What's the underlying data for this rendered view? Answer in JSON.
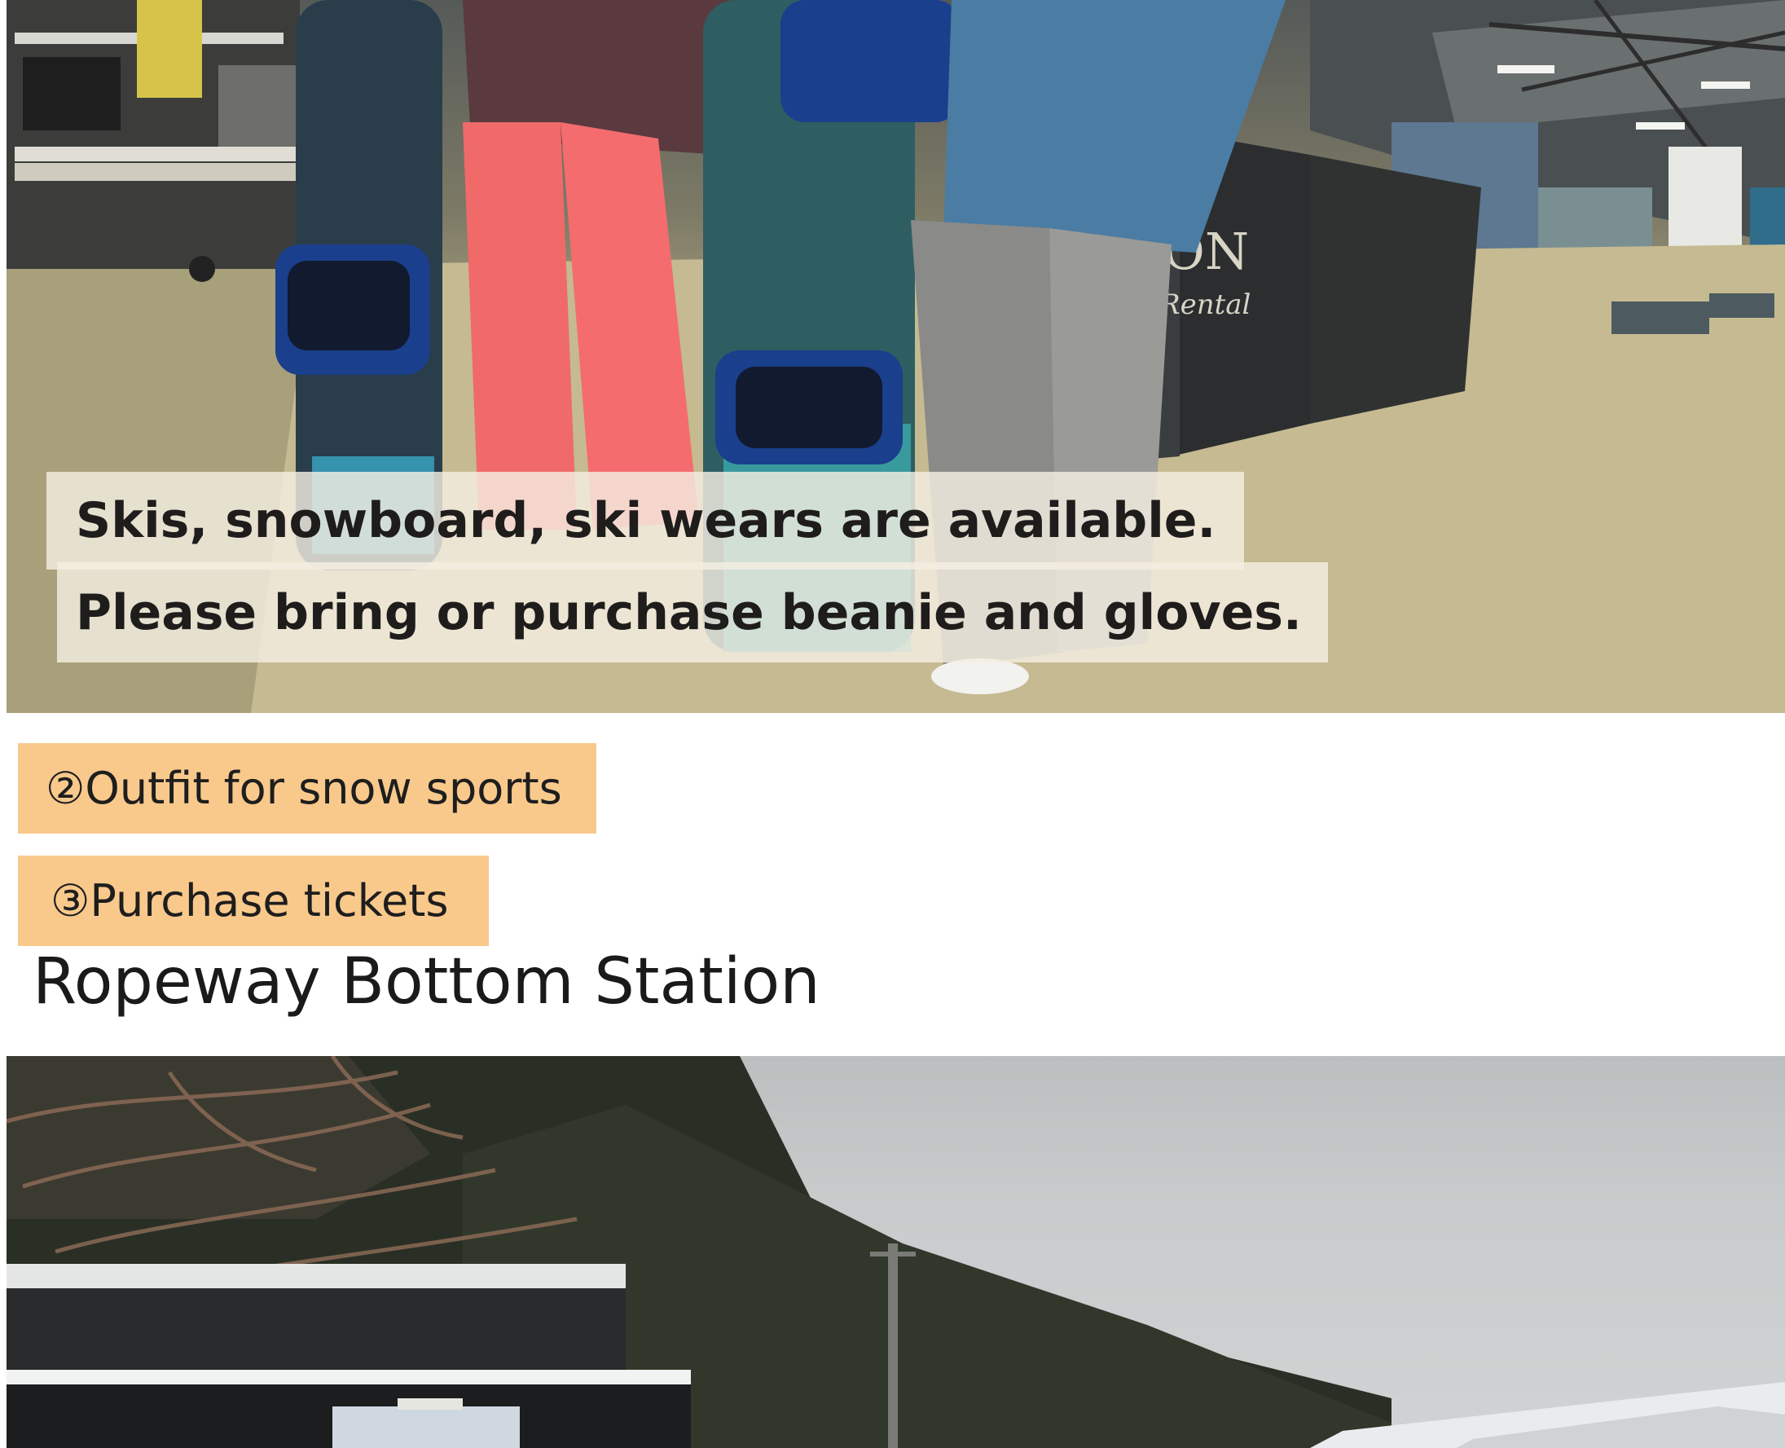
{
  "rental_photo": {
    "caption_line_1": "Skis, snowboard, ski wears are available.",
    "caption_line_2": "Please bring or purchase beanie and gloves.",
    "sign_text_1": "ON",
    "sign_text_2": "Rental"
  },
  "steps": {
    "step_2": "②Outfit for snow sports",
    "step_3": "③Purchase tickets"
  },
  "section": {
    "title": "Ropeway Bottom Station"
  },
  "colors": {
    "tag_background": "#f9c98c",
    "caption_background": "#f4eee2",
    "text": "#1e1e1e"
  }
}
